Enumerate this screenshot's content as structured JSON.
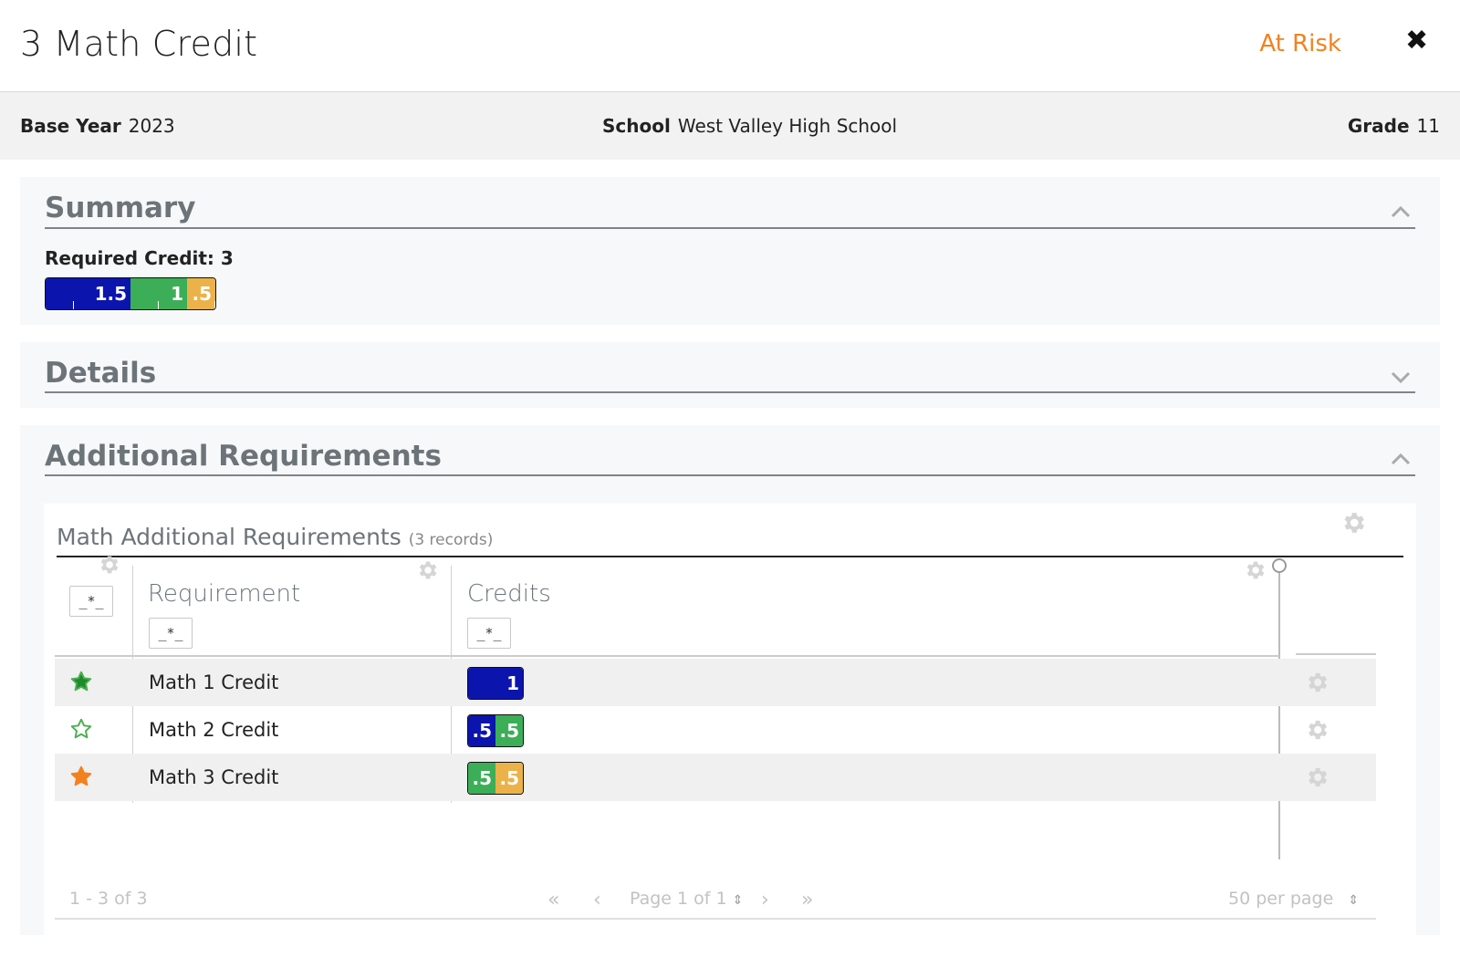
{
  "header": {
    "title": "3 Math Credit",
    "status": "At Risk",
    "close_icon": "close-icon"
  },
  "info": {
    "base_year_label": "Base Year",
    "base_year": "2023",
    "school_label": "School",
    "school": "West Valley High School",
    "grade_label": "Grade",
    "grade": "11"
  },
  "summary": {
    "title": "Summary",
    "required_label": "Required Credit: 3",
    "bar": [
      {
        "label": "1.5",
        "credits": 1.5,
        "color": "#0b14ad"
      },
      {
        "label": "1",
        "credits": 1,
        "color": "#3cae57"
      },
      {
        "label": ".5",
        "credits": 0.5,
        "color": "#ebb24a"
      }
    ]
  },
  "details": {
    "title": "Details"
  },
  "additional": {
    "title": "Additional Requirements",
    "grid": {
      "title": "Math Additional Requirements",
      "count": "(3 records)",
      "columns": {
        "requirement": "Requirement",
        "credits": "Credits"
      },
      "filter_text": "_*_",
      "rows": [
        {
          "requirement": "Math 1 Credit",
          "star": "filled-green",
          "credits": [
            {
              "label": "1",
              "color": "#0b14ad"
            }
          ]
        },
        {
          "requirement": "Math 2 Credit",
          "star": "outline-green",
          "credits": [
            {
              "label": ".5",
              "color": "#0b14ad"
            },
            {
              "label": ".5",
              "color": "#3cae57"
            }
          ]
        },
        {
          "requirement": "Math 3 Credit",
          "star": "filled-orange",
          "credits": [
            {
              "label": ".5",
              "color": "#3cae57"
            },
            {
              "label": ".5",
              "color": "#ebb24a"
            }
          ]
        }
      ],
      "footer": {
        "range": "1 - 3 of 3",
        "page": "Page 1 of 1",
        "per_page": "50 per page"
      }
    }
  },
  "colors": {
    "status": "#f2821f",
    "blue": "#0b14ad",
    "green": "#3cae57",
    "yellow": "#ebb24a"
  }
}
